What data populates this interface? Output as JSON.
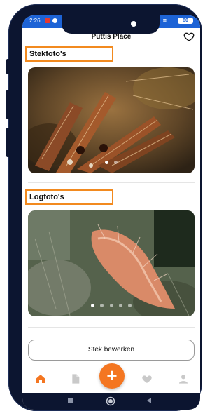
{
  "status_bar": {
    "time": "2:26",
    "battery": "80"
  },
  "app": {
    "title": "Puttis Place"
  },
  "sections": [
    {
      "title": "Stekfoto's",
      "dots": 2,
      "active_dot": 1
    },
    {
      "title": "Logfoto's",
      "dots": 5,
      "active_dot": 0
    }
  ],
  "edit_button": "Stek bewerken",
  "tabbar": {
    "items": [
      {
        "icon": "home-icon",
        "active": true
      },
      {
        "icon": "document-icon",
        "active": false
      },
      {
        "icon": "heart-icon",
        "active": false
      },
      {
        "icon": "profile-icon",
        "active": false
      }
    ],
    "fab_icon": "plus-icon"
  },
  "colors": {
    "accent": "#f47621",
    "status_bar": "#1d63d6",
    "highlight_border": "#f28a1f",
    "inactive_icon": "#c9c9c9"
  }
}
